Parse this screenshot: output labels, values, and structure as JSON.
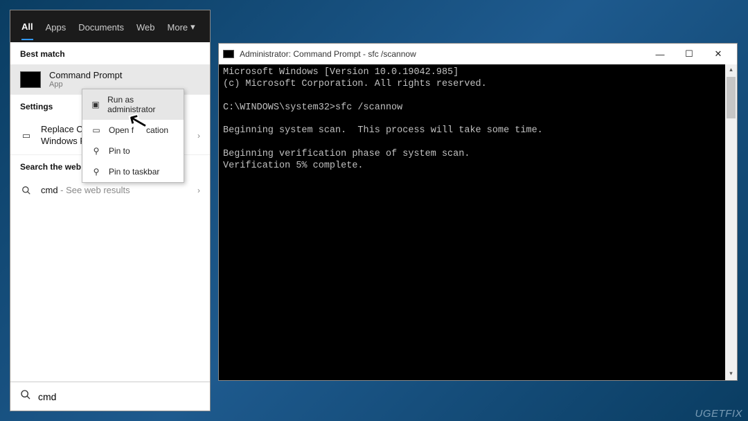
{
  "search": {
    "tabs": {
      "all": "All",
      "apps": "Apps",
      "documents": "Documents",
      "web": "Web",
      "more": "More"
    },
    "best_match_header": "Best match",
    "best_match": {
      "title": "Command Prompt",
      "subtitle": "App"
    },
    "settings_header": "Settings",
    "settings_item": "Replace Command Prompt with Windows PowerShell",
    "settings_item_visible": "Replace Co\nWindows Pc",
    "web_header": "Search the web",
    "web_item_prefix": "cmd",
    "web_item_suffix": " - See web results",
    "input_value": "cmd"
  },
  "context_menu": {
    "run_admin": "Run as administrator",
    "open_loc": "Open file location",
    "pin_start": "Pin to Start",
    "pin_task": "Pin to taskbar"
  },
  "cmd": {
    "title": "Administrator: Command Prompt - sfc  /scannow",
    "lines": [
      "Microsoft Windows [Version 10.0.19042.985]",
      "(c) Microsoft Corporation. All rights reserved.",
      "",
      "C:\\WINDOWS\\system32>sfc /scannow",
      "",
      "Beginning system scan.  This process will take some time.",
      "",
      "Beginning verification phase of system scan.",
      "Verification 5% complete."
    ]
  },
  "watermark": "UGETFIX"
}
